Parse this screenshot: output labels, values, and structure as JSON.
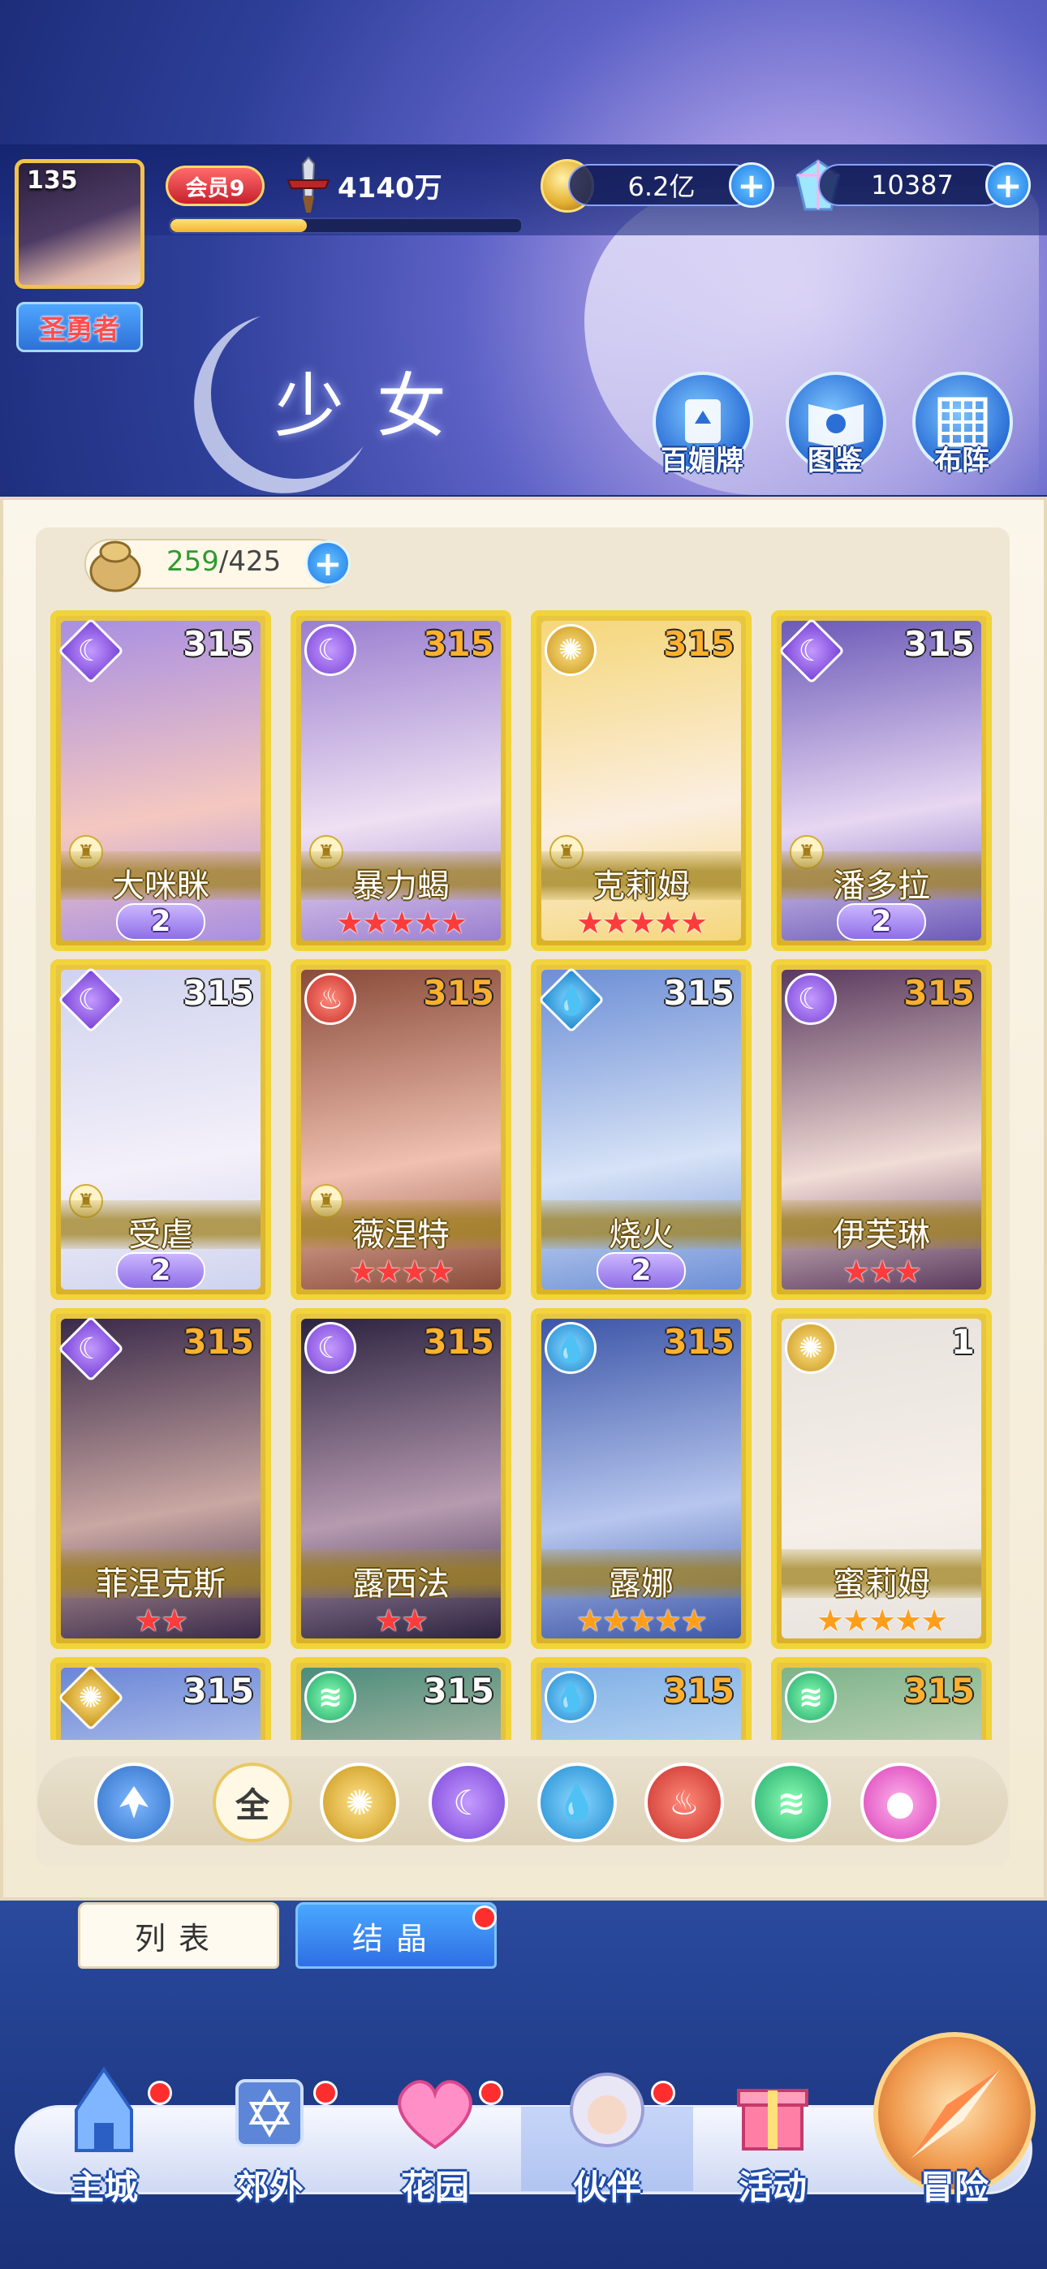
{
  "player": {
    "level": "135",
    "title": "圣勇者",
    "vip": "会员9",
    "power": "4140万",
    "exp_progress": 0.39
  },
  "resources": {
    "gold": "6.2亿",
    "gems": "10387"
  },
  "header": {
    "page_title": "少女",
    "buttons": [
      {
        "label": "百媚牌",
        "icon": "card-deck-icon"
      },
      {
        "label": "图鉴",
        "icon": "book-icon"
      },
      {
        "label": "布阵",
        "icon": "formation-grid-icon"
      }
    ]
  },
  "capacity": {
    "current": "259",
    "separator": "/",
    "max": "425"
  },
  "cards": [
    {
      "name": "大咪眯",
      "level": "315",
      "element": "moon",
      "rank": "2",
      "stars": 0,
      "star_color": "",
      "art": [
        "#a98fe2",
        "#f4c8c0"
      ]
    },
    {
      "name": "暴力蝎",
      "level": "315",
      "element": "moon",
      "rank": "",
      "stars": 5,
      "star_color": "red",
      "art": [
        "#9a7fd0",
        "#efe0f2"
      ]
    },
    {
      "name": "克莉姆",
      "level": "315",
      "element": "sun",
      "rank": "",
      "stars": 5,
      "star_color": "red",
      "art": [
        "#f5d77a",
        "#fbeee0"
      ]
    },
    {
      "name": "潘多拉",
      "level": "315",
      "element": "moon",
      "rank": "2",
      "stars": 0,
      "star_color": "",
      "art": [
        "#6c5ab8",
        "#e7d7f2"
      ]
    },
    {
      "name": "受虐",
      "level": "315",
      "element": "moon",
      "rank": "2",
      "stars": 0,
      "star_color": "",
      "art": [
        "#cfd3ee",
        "#f4f0fa"
      ]
    },
    {
      "name": "薇涅特",
      "level": "315",
      "element": "fire",
      "rank": "",
      "stars": 4,
      "star_color": "red",
      "art": [
        "#8a4b3a",
        "#f0c0b0"
      ]
    },
    {
      "name": "烧火",
      "level": "315",
      "element": "water",
      "rank": "2",
      "stars": 0,
      "star_color": "",
      "art": [
        "#6d8fd6",
        "#d6e2f6"
      ]
    },
    {
      "name": "伊芙琳",
      "level": "315",
      "element": "moon",
      "rank": "",
      "stars": 3,
      "star_color": "red",
      "art": [
        "#5a3a5e",
        "#f2dcd6"
      ]
    },
    {
      "name": "菲涅克斯",
      "level": "315",
      "element": "moon",
      "rank": "",
      "stars": 2,
      "star_color": "red",
      "art": [
        "#3a2a4a",
        "#c9a7a2"
      ]
    },
    {
      "name": "露西法",
      "level": "315",
      "element": "moon",
      "rank": "",
      "stars": 2,
      "star_color": "red",
      "art": [
        "#2c2340",
        "#b69ab0"
      ]
    },
    {
      "name": "露娜",
      "level": "315",
      "element": "water",
      "rank": "",
      "stars": 5,
      "star_color": "gold",
      "art": [
        "#3d56a8",
        "#b6c6ee"
      ]
    },
    {
      "name": "蜜莉姆",
      "level": "1",
      "element": "sun",
      "rank": "",
      "stars": 5,
      "star_color": "gold",
      "art": [
        "#e7e2de",
        "#f6efe8"
      ]
    },
    {
      "name": "",
      "level": "315",
      "element": "sun",
      "rank": "",
      "stars": 0,
      "star_color": "",
      "art": [
        "#6a86d6",
        "#e5ecfb"
      ]
    },
    {
      "name": "",
      "level": "315",
      "element": "wind",
      "rank": "",
      "stars": 0,
      "star_color": "",
      "art": [
        "#4b8d7a",
        "#f1d5c6"
      ]
    },
    {
      "name": "",
      "level": "315",
      "element": "water",
      "rank": "",
      "stars": 0,
      "star_color": "",
      "art": [
        "#7fb0e6",
        "#e3eefa"
      ]
    },
    {
      "name": "",
      "level": "315",
      "element": "wind",
      "rank": "",
      "stars": 0,
      "star_color": "",
      "art": [
        "#7db48a",
        "#f3e7d8"
      ]
    }
  ],
  "filters": {
    "all_label": "全",
    "items": [
      "up-arrow-icon",
      "all",
      "sun-icon",
      "moon-icon",
      "water-icon",
      "fire-icon",
      "wind-icon",
      "pink-orb-icon"
    ]
  },
  "tabs": {
    "list": "列表",
    "crystal": "结晶"
  },
  "nav": [
    {
      "label": "主城",
      "icon": "castle-icon",
      "dot": true
    },
    {
      "label": "郊外",
      "icon": "magic-circle-icon",
      "dot": true
    },
    {
      "label": "花园",
      "icon": "heart-icon",
      "dot": true
    },
    {
      "label": "伙伴",
      "icon": "companion-portrait-icon",
      "dot": true
    },
    {
      "label": "活动",
      "icon": "gift-box-icon",
      "dot": false
    },
    {
      "label": "冒险",
      "icon": "compass-icon",
      "dot": false
    }
  ],
  "colors": {
    "card_gold": "#f1d33a",
    "header_blue": "#2e3f99",
    "star_red": "#ff3b3b",
    "star_gold": "#ff9e1b",
    "capacity_green": "#2f9a2f"
  }
}
